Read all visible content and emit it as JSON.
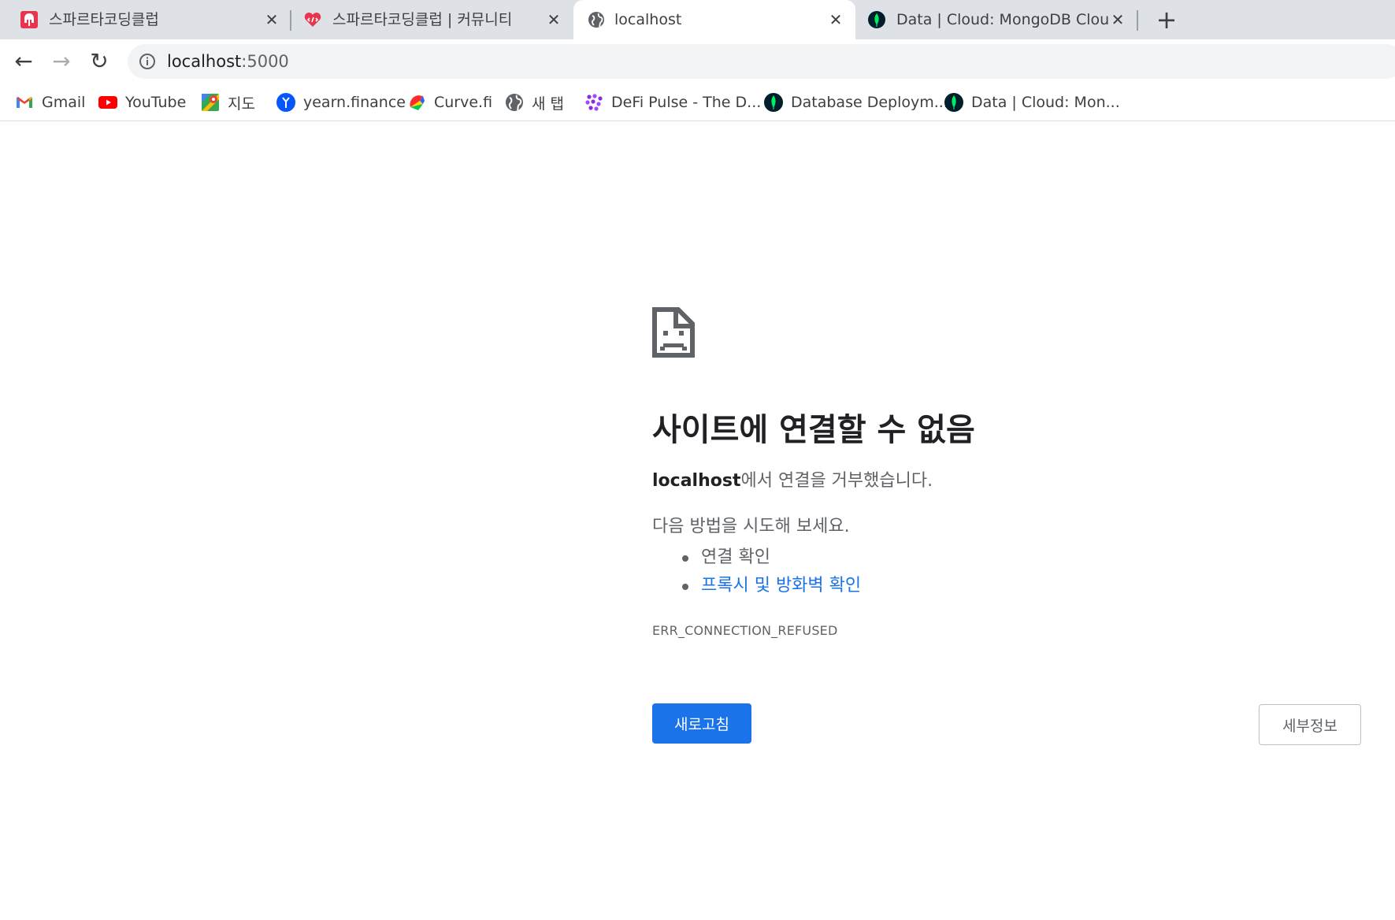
{
  "tabs": [
    {
      "title": "스파르타코딩클럽",
      "icon": "spartan-helmet-icon",
      "active": false
    },
    {
      "title": "스파르타코딩클럽 | 커뮤니티",
      "icon": "code-heart-icon",
      "active": false
    },
    {
      "title": "localhost",
      "icon": "globe-icon",
      "active": true
    },
    {
      "title": "Data | Cloud: MongoDB Cloud",
      "icon": "mongodb-leaf-icon",
      "active": false
    }
  ],
  "tab_close_glyph": "✕",
  "new_tab_glyph": "+",
  "toolbar": {
    "back_glyph": "←",
    "forward_glyph": "→",
    "reload_glyph": "↻",
    "url_host": "localhost",
    "url_port": ":5000"
  },
  "bookmarks": [
    {
      "label": "Gmail",
      "icon": "gmail-icon"
    },
    {
      "label": "YouTube",
      "icon": "youtube-icon"
    },
    {
      "label": "지도",
      "icon": "maps-icon"
    },
    {
      "label": "yearn.finance",
      "icon": "yearn-icon"
    },
    {
      "label": "Curve.fi",
      "icon": "curve-icon"
    },
    {
      "label": "새 탭",
      "icon": "globe-icon"
    },
    {
      "label": "DeFi Pulse - The D...",
      "icon": "defi-pulse-icon"
    },
    {
      "label": "Database Deploym...",
      "icon": "mongodb-leaf-icon"
    },
    {
      "label": "Data | Cloud: Mon...",
      "icon": "mongodb-leaf-icon"
    }
  ],
  "error": {
    "title": "사이트에 연결할 수 없음",
    "host": "localhost",
    "description_suffix": "에서 연결을 거부했습니다.",
    "try_heading": "다음 방법을 시도해 보세요.",
    "suggestion_1": "연결 확인",
    "suggestion_2": "프록시 및 방화벽 확인",
    "code": "ERR_CONNECTION_REFUSED",
    "reload_label": "새로고침",
    "details_label": "세부정보"
  },
  "colors": {
    "accent": "#1a73e8",
    "tabstrip": "#dee1e6",
    "omnibox": "#f1f3f4",
    "secondary_text": "#5f6368"
  }
}
